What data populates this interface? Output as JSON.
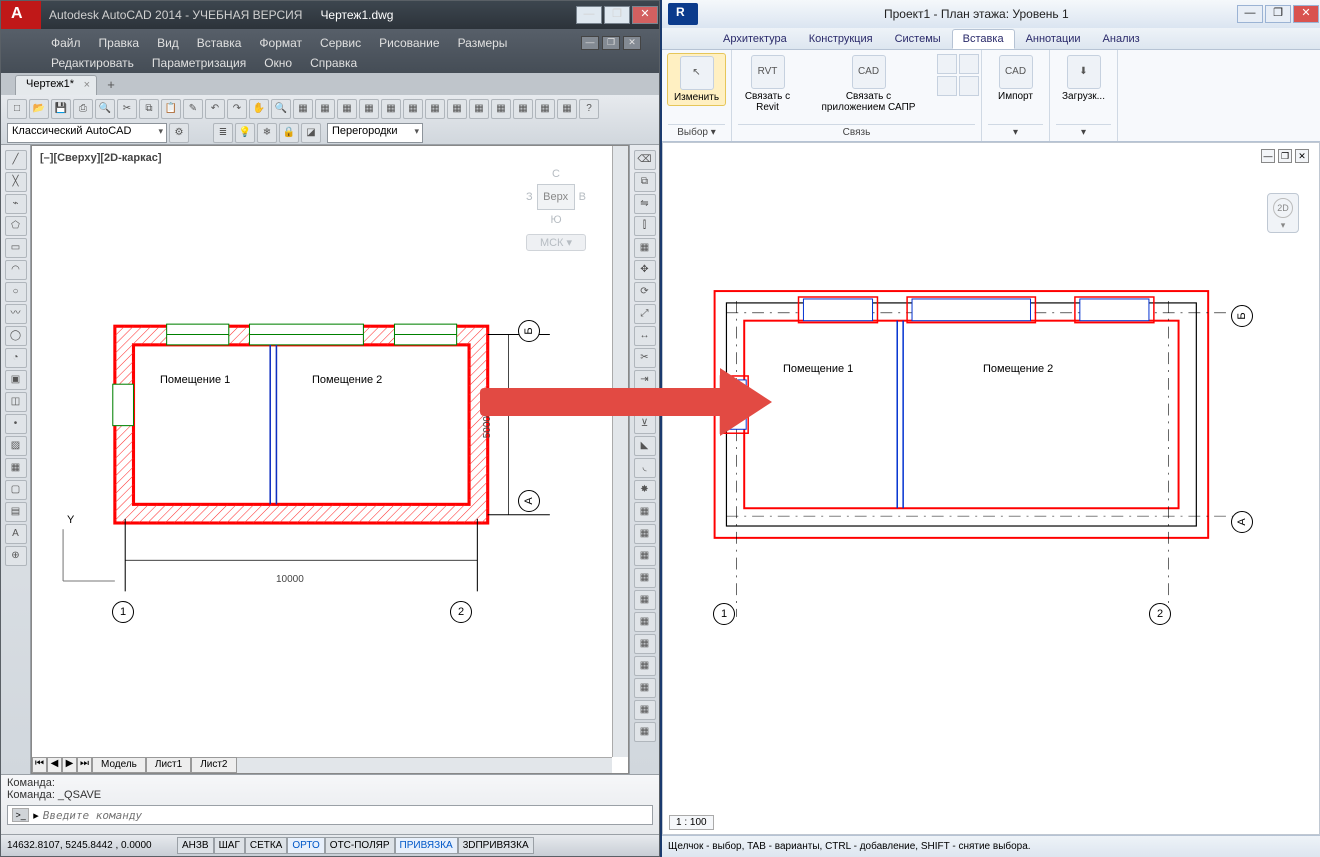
{
  "acad": {
    "title": "Autodesk AutoCAD 2014 - УЧЕБНАЯ ВЕРСИЯ",
    "docname": "Чертеж1.dwg",
    "menu_row1": [
      "Файл",
      "Правка",
      "Вид",
      "Вставка",
      "Формат",
      "Сервис",
      "Рисование",
      "Размеры"
    ],
    "menu_row2": [
      "Редактировать",
      "Параметризация",
      "Окно",
      "Справка"
    ],
    "doctab": "Чертеж1*",
    "workspace": "Классический AutoCAD",
    "layer_combo": "Перегородки",
    "view_label": "[–][Сверху][2D-каркас]",
    "viewcube": {
      "n": "С",
      "w": "З",
      "e": "В",
      "s": "Ю",
      "face": "Верх",
      "wcs": "МСК ▾"
    },
    "room1": "Помещение 1",
    "room2": "Помещение 2",
    "dim_w": "10000",
    "dim_h": "5000",
    "grids": {
      "g1": "1",
      "g2": "2",
      "gA": "А",
      "gB": "Б"
    },
    "tabs": {
      "model": "Модель",
      "l1": "Лист1",
      "l2": "Лист2"
    },
    "cmd_hist1": "Команда:",
    "cmd_hist2": "Команда: _QSAVE",
    "cmd_placeholder": "Введите команду",
    "status": {
      "coords": "14632.8107, 5245.8442 , 0.0000",
      "buttons": [
        "АНЗВ",
        "ШАГ",
        "СЕТКА",
        "ОРТО",
        "ОТС-ПОЛЯР",
        "ПРИВЯЗКА",
        "3DПРИВЯЗКА"
      ],
      "on": [
        3,
        5
      ]
    },
    "ucs_y": "Y"
  },
  "rvt": {
    "title": "Проект1 - План этажа: Уровень 1",
    "tabs": [
      "Архитектура",
      "Конструкция",
      "Системы",
      "Вставка",
      "Аннотации",
      "Анализ"
    ],
    "active_tab": 3,
    "ribbon": {
      "select_panel": {
        "btn": "Изменить",
        "caption": "Выбор ▾"
      },
      "link_panel": {
        "b1": "Связать с Revit",
        "b2": "Связать с приложением САПР",
        "caption": "Связь"
      },
      "import_panel": {
        "b1": "Импорт",
        "caption": ""
      },
      "load_panel": {
        "b1": "Загрузк...",
        "caption": ""
      },
      "icons": {
        "rvt": "RVT",
        "cad": "CAD",
        "cad2": "CAD"
      }
    },
    "room1": "Помещение 1",
    "room2": "Помещение 2",
    "grids": {
      "g1": "1",
      "g2": "2",
      "gA": "А",
      "gB": "Б"
    },
    "navwheel": "2D",
    "scale": "1 : 100",
    "status_hint": "Щелчок - выбор, TAB - варианты, CTRL - добавление, SHIFT - снятие выбора."
  }
}
